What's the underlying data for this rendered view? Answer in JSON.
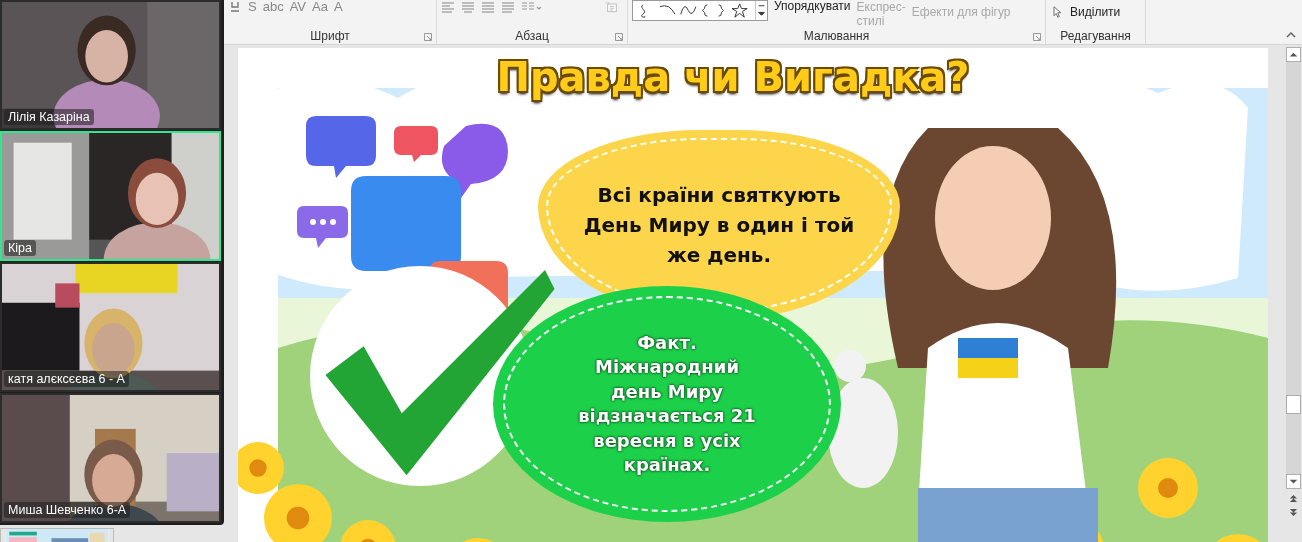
{
  "participants": [
    {
      "name": "Лілія Казаріна",
      "speaking": false
    },
    {
      "name": "Кіра",
      "speaking": true
    },
    {
      "name": "катя алєксєєва 6 - А",
      "speaking": false
    },
    {
      "name": "Миша Шевченко 6-А",
      "speaking": false
    }
  ],
  "ribbon": {
    "font_tools": [
      "S",
      "abc",
      "AV",
      "Aa",
      "A"
    ],
    "arrange": {
      "label": "Упорядкувати",
      "disabled": false
    },
    "quick_styles": {
      "label_lines": [
        "Експрес-",
        "стилі"
      ],
      "disabled": true
    },
    "shape_effects": {
      "label": "Ефекти для фігур",
      "disabled": true
    },
    "select": {
      "label": "Виділити",
      "disabled": false
    },
    "groups": [
      "Шрифт",
      "Абзац",
      "Малювання",
      "Редагування"
    ]
  },
  "slide": {
    "title": "Правда чи Вигадка?",
    "statement_lines": [
      "Всі країни святкують",
      "День Миру в один і той",
      "же день."
    ],
    "answer_lines": [
      "Факт.",
      "Міжнародний",
      "день Миру",
      "відзначається 21",
      "вересня в усіх",
      "країнах."
    ]
  }
}
